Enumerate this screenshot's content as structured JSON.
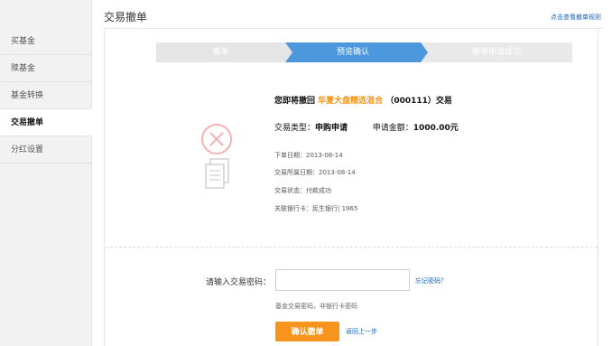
{
  "sidebar": {
    "items": [
      {
        "label": "买基金"
      },
      {
        "label": "赎基金"
      },
      {
        "label": "基金转换"
      },
      {
        "label": "交易撤单",
        "active": true
      },
      {
        "label": "分红设置"
      }
    ]
  },
  "page": {
    "title": "交易撤单",
    "help_link": "点击查看撤单规则"
  },
  "steps": [
    "撤单",
    "预览确认",
    "撤单申请成功"
  ],
  "active_step": 2,
  "icons": {
    "warning": "x-circle-icon",
    "documents": "documents-icon"
  },
  "summary": {
    "prefix": "您即将撤回",
    "fund_name": "华夏大盘精选混合",
    "fund_code": "（000111）",
    "suffix": "交易",
    "type_label": "交易类型：",
    "type_value": "申购申请",
    "amount_label": "申请金额：",
    "amount_value": "1000.00元"
  },
  "details": [
    "下单日期：2013-08-14",
    "交易所属日期：2013-08-14",
    "交易状态：付款成功",
    "关联银行卡：民生银行| 1965"
  ],
  "form": {
    "password_label": "请输入交易密码：",
    "password_value": "",
    "forgot_link": "忘记密码？",
    "hint": "基金交易密码，非银行卡密码",
    "confirm_label": "确认撤单",
    "back_link": "返回上一步"
  },
  "colors": {
    "accent": "#f7941d",
    "link": "#1a64b4",
    "step_active": "#4d97dd",
    "fund_name": "#f29417"
  }
}
